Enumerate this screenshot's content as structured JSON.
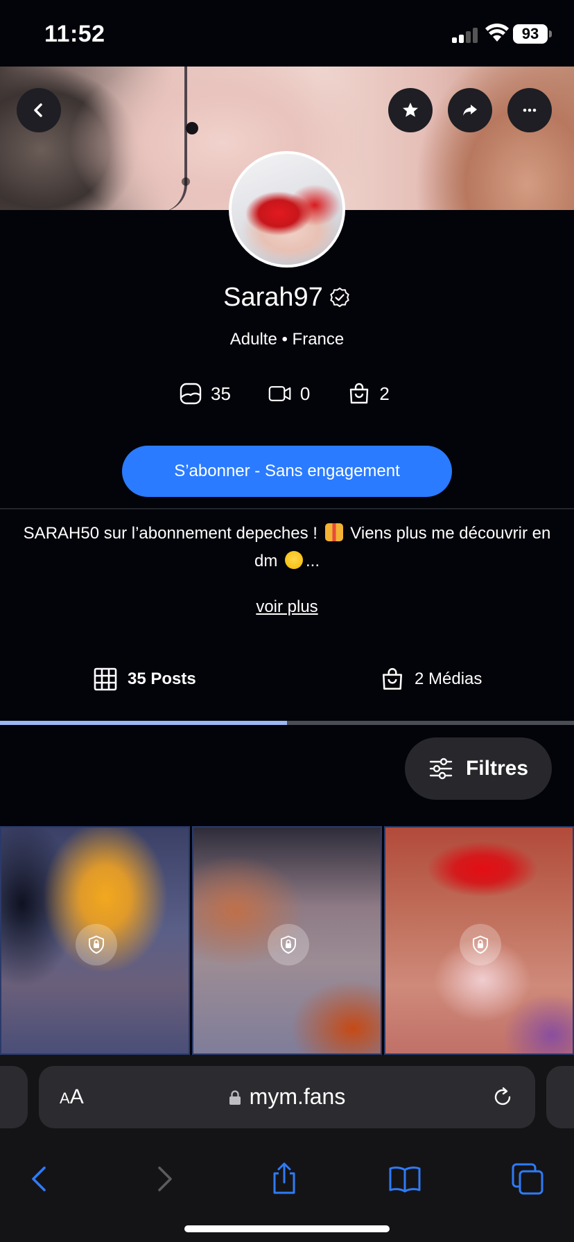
{
  "status": {
    "time": "11:52",
    "battery": "93"
  },
  "profile": {
    "username": "Sarah97",
    "subtitle": "Adulte • France",
    "stats": {
      "photos": "35",
      "videos": "0",
      "medias": "2"
    },
    "subscribe_label": "S’abonner - Sans engagement",
    "bio_part1": "SARAH50 sur l’abonnement depeches !",
    "bio_part2": "Viens plus me découvrir en dm",
    "bio_ellipsis": "...",
    "see_more": "voir plus"
  },
  "tabs": {
    "posts_label": "35 Posts",
    "medias_label": "2 Médias",
    "active_fraction": 0.5
  },
  "filters_label": "Filtres",
  "browser": {
    "text_size_label_small": "A",
    "text_size_label_large": "A",
    "url": "mym.fans"
  },
  "colors": {
    "accent": "#2a7bff",
    "tab_indicator": "#9ab8f2",
    "background": "#03040a"
  },
  "icons": [
    "back-icon",
    "star-icon",
    "share-icon",
    "more-icon",
    "verified-icon",
    "image-icon",
    "video-icon",
    "bag-icon",
    "grid-icon",
    "filters-icon",
    "lock-icon",
    "reload-icon",
    "chevron-left-icon",
    "chevron-right-icon",
    "share-sheet-icon",
    "bookmarks-icon",
    "tabs-icon"
  ]
}
